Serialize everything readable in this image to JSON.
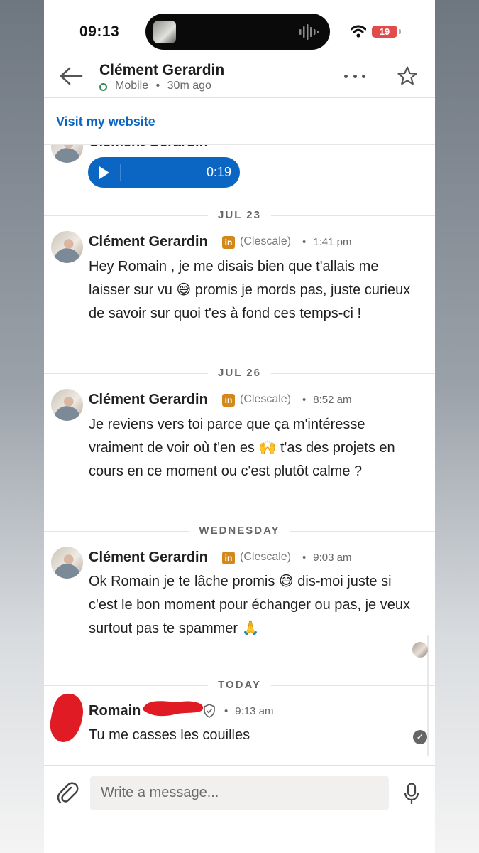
{
  "status_bar": {
    "time": "09:13",
    "battery": "19"
  },
  "header": {
    "contact_name": "Clément Gerardin",
    "presence": "Mobile",
    "separator": "•",
    "last_seen": "30m ago"
  },
  "website_link": "Visit my website",
  "audio": {
    "duration": "0:19"
  },
  "dates": [
    "JUL 23",
    "JUL 26",
    "WEDNESDAY",
    "TODAY"
  ],
  "messages": [
    {
      "sender": "Clément Gerardin",
      "company": "(Clescale)",
      "time": "1:41 pm",
      "text": "Hey Romain , je me disais bien que t'allais me laisser sur vu 😅 promis je mords pas, juste curieux de savoir sur quoi t'es à fond ces temps-ci !"
    },
    {
      "sender": "Clément Gerardin",
      "company": "(Clescale)",
      "time": "8:52 am",
      "text": "Je reviens vers toi parce que ça m'intéresse vraiment de voir où t'en es 🙌 t'as des projets en cours en ce moment ou c'est plutôt calme ?"
    },
    {
      "sender": "Clément Gerardin",
      "company": "(Clescale)",
      "time": "9:03 am",
      "text": "Ok Romain je te lâche promis 😅 dis-moi juste si c'est le bon moment pour échanger ou pas, je veux surtout pas te spammer 🙏"
    },
    {
      "sender": "Romain",
      "time": "9:13 am",
      "text": "Tu me casses les couilles"
    }
  ],
  "badge": {
    "linkedin_letters": "in",
    "dot": "•",
    "check": "✓"
  },
  "composer": {
    "placeholder": "Write a message..."
  },
  "colors": {
    "brand_blue": "#0a66c2",
    "premium_gold": "#d4881c",
    "redaction_red": "#e01b24"
  }
}
